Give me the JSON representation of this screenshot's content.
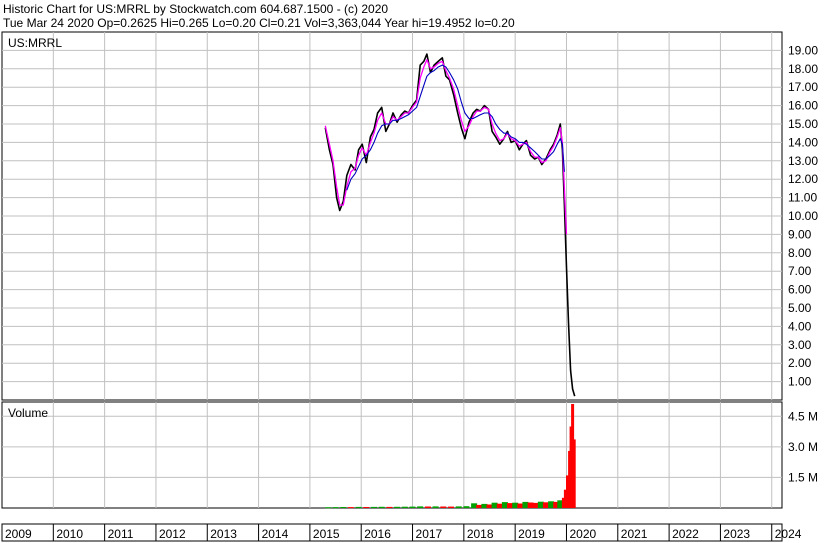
{
  "header": {
    "line1": "Historic Chart for US:MRRL by Stockwatch.com 604.687.1500 - (c) 2020",
    "line2": "Tue Mar 24 2020   Op=0.2625   Hi=0.265   Lo=0.20   Cl=0.21   Vol=3,363,044   Year hi=19.4952   lo=0.20"
  },
  "colors": {
    "background": "#ffffff",
    "grid": "#c0c0c0",
    "price_bars": "#000000",
    "moving_avg_short": "#ff00ff",
    "moving_avg_long": "#0000c0",
    "volume_up": "#00a000",
    "volume_down": "#ff0000"
  },
  "chart_data": [
    {
      "type": "line",
      "label": "US:MRRL",
      "x_ticks": [
        "2009",
        "2010",
        "2011",
        "2012",
        "2013",
        "2014",
        "2015",
        "2016",
        "2017",
        "2018",
        "2019",
        "2020",
        "2021",
        "2022",
        "2023",
        "2024"
      ],
      "y_ticks": [
        "19.00",
        "18.00",
        "17.00",
        "16.00",
        "15.00",
        "14.00",
        "13.00",
        "12.00",
        "11.00",
        "10.00",
        "9.00",
        "8.00",
        "7.00",
        "6.00",
        "5.00",
        "4.00",
        "3.00",
        "2.00",
        "1.00"
      ],
      "xlim": [
        2009.0,
        2024.2
      ],
      "ylim": [
        0,
        20.0
      ],
      "grid": true,
      "series": [
        {
          "values": [
            [
              2015.3,
              14.8
            ],
            [
              2015.38,
              13.6
            ],
            [
              2015.45,
              12.8
            ],
            [
              2015.52,
              11.0
            ],
            [
              2015.58,
              10.3
            ],
            [
              2015.65,
              10.8
            ],
            [
              2015.72,
              12.2
            ],
            [
              2015.8,
              12.8
            ],
            [
              2015.88,
              12.5
            ],
            [
              2015.95,
              13.6
            ],
            [
              2016.02,
              13.9
            ],
            [
              2016.1,
              12.9
            ],
            [
              2016.18,
              14.3
            ],
            [
              2016.25,
              14.7
            ],
            [
              2016.32,
              15.6
            ],
            [
              2016.4,
              15.9
            ],
            [
              2016.48,
              14.6
            ],
            [
              2016.55,
              15.0
            ],
            [
              2016.62,
              15.6
            ],
            [
              2016.7,
              15.1
            ],
            [
              2016.78,
              15.5
            ],
            [
              2016.85,
              15.7
            ],
            [
              2016.92,
              15.6
            ],
            [
              2017.0,
              16.0
            ],
            [
              2017.08,
              16.3
            ],
            [
              2017.15,
              18.2
            ],
            [
              2017.22,
              18.4
            ],
            [
              2017.28,
              18.8
            ],
            [
              2017.35,
              17.8
            ],
            [
              2017.42,
              18.2
            ],
            [
              2017.5,
              18.4
            ],
            [
              2017.58,
              18.6
            ],
            [
              2017.65,
              17.6
            ],
            [
              2017.72,
              17.4
            ],
            [
              2017.8,
              16.6
            ],
            [
              2017.88,
              15.6
            ],
            [
              2017.95,
              14.8
            ],
            [
              2018.02,
              14.2
            ],
            [
              2018.1,
              15.1
            ],
            [
              2018.18,
              15.6
            ],
            [
              2018.25,
              15.8
            ],
            [
              2018.32,
              15.7
            ],
            [
              2018.4,
              16.0
            ],
            [
              2018.48,
              15.8
            ],
            [
              2018.55,
              14.6
            ],
            [
              2018.62,
              14.3
            ],
            [
              2018.7,
              13.9
            ],
            [
              2018.78,
              14.2
            ],
            [
              2018.85,
              14.6
            ],
            [
              2018.92,
              14.0
            ],
            [
              2019.0,
              14.1
            ],
            [
              2019.08,
              13.6
            ],
            [
              2019.15,
              13.9
            ],
            [
              2019.22,
              14.1
            ],
            [
              2019.3,
              13.3
            ],
            [
              2019.38,
              13.1
            ],
            [
              2019.45,
              13.2
            ],
            [
              2019.52,
              12.8
            ],
            [
              2019.6,
              13.1
            ],
            [
              2019.68,
              13.6
            ],
            [
              2019.75,
              13.9
            ],
            [
              2019.82,
              14.4
            ],
            [
              2019.88,
              15.0
            ],
            [
              2019.92,
              13.6
            ],
            [
              2019.96,
              10.6
            ],
            [
              2020.0,
              7.2
            ],
            [
              2020.04,
              4.2
            ],
            [
              2020.08,
              1.6
            ],
            [
              2020.12,
              0.6
            ],
            [
              2020.16,
              0.21
            ]
          ]
        },
        {
          "name": "",
          "values": [
            [
              2015.3,
              14.9
            ],
            [
              2015.38,
              13.9
            ],
            [
              2015.45,
              13.0
            ],
            [
              2015.52,
              11.6
            ],
            [
              2015.58,
              10.6
            ],
            [
              2015.65,
              10.6
            ],
            [
              2015.72,
              11.6
            ],
            [
              2015.8,
              12.4
            ],
            [
              2015.88,
              12.6
            ],
            [
              2015.95,
              13.3
            ],
            [
              2016.02,
              13.7
            ],
            [
              2016.1,
              13.3
            ],
            [
              2016.18,
              14.0
            ],
            [
              2016.25,
              14.5
            ],
            [
              2016.32,
              15.2
            ],
            [
              2016.4,
              15.6
            ],
            [
              2016.48,
              15.0
            ],
            [
              2016.55,
              15.0
            ],
            [
              2016.62,
              15.4
            ],
            [
              2016.7,
              15.2
            ],
            [
              2016.78,
              15.4
            ],
            [
              2016.85,
              15.6
            ],
            [
              2016.92,
              15.6
            ],
            [
              2017.0,
              15.9
            ],
            [
              2017.08,
              16.2
            ],
            [
              2017.15,
              17.5
            ],
            [
              2017.22,
              18.1
            ],
            [
              2017.28,
              18.5
            ],
            [
              2017.35,
              18.0
            ],
            [
              2017.42,
              18.1
            ],
            [
              2017.5,
              18.3
            ],
            [
              2017.58,
              18.4
            ],
            [
              2017.65,
              17.9
            ],
            [
              2017.72,
              17.5
            ],
            [
              2017.8,
              16.9
            ],
            [
              2017.88,
              16.0
            ],
            [
              2017.95,
              15.2
            ],
            [
              2018.02,
              14.6
            ],
            [
              2018.1,
              14.9
            ],
            [
              2018.18,
              15.4
            ],
            [
              2018.25,
              15.7
            ],
            [
              2018.32,
              15.7
            ],
            [
              2018.4,
              15.9
            ],
            [
              2018.48,
              15.8
            ],
            [
              2018.55,
              15.0
            ],
            [
              2018.62,
              14.5
            ],
            [
              2018.7,
              14.1
            ],
            [
              2018.78,
              14.2
            ],
            [
              2018.85,
              14.5
            ],
            [
              2018.92,
              14.2
            ],
            [
              2019.0,
              14.1
            ],
            [
              2019.08,
              13.8
            ],
            [
              2019.15,
              13.9
            ],
            [
              2019.22,
              14.0
            ],
            [
              2019.3,
              13.5
            ],
            [
              2019.38,
              13.2
            ],
            [
              2019.45,
              13.2
            ],
            [
              2019.52,
              12.9
            ],
            [
              2019.6,
              13.0
            ],
            [
              2019.68,
              13.5
            ],
            [
              2019.75,
              13.8
            ],
            [
              2019.82,
              14.3
            ],
            [
              2019.88,
              14.8
            ],
            [
              2019.92,
              14.0
            ],
            [
              2019.96,
              11.5
            ],
            [
              2020.0,
              9.0
            ]
          ]
        },
        {
          "name": "",
          "values": [
            [
              2015.72,
              11.4
            ],
            [
              2015.8,
              12.0
            ],
            [
              2015.88,
              12.3
            ],
            [
              2015.95,
              12.7
            ],
            [
              2016.02,
              13.1
            ],
            [
              2016.1,
              13.3
            ],
            [
              2016.18,
              13.6
            ],
            [
              2016.25,
              14.0
            ],
            [
              2016.32,
              14.5
            ],
            [
              2016.4,
              14.9
            ],
            [
              2016.48,
              15.0
            ],
            [
              2016.55,
              15.0
            ],
            [
              2016.62,
              15.2
            ],
            [
              2016.7,
              15.2
            ],
            [
              2016.78,
              15.3
            ],
            [
              2016.85,
              15.4
            ],
            [
              2016.92,
              15.5
            ],
            [
              2017.0,
              15.7
            ],
            [
              2017.08,
              15.9
            ],
            [
              2017.15,
              16.5
            ],
            [
              2017.22,
              17.1
            ],
            [
              2017.28,
              17.6
            ],
            [
              2017.35,
              17.8
            ],
            [
              2017.42,
              17.9
            ],
            [
              2017.5,
              18.1
            ],
            [
              2017.58,
              18.2
            ],
            [
              2017.65,
              18.1
            ],
            [
              2017.72,
              17.8
            ],
            [
              2017.8,
              17.4
            ],
            [
              2017.88,
              16.9
            ],
            [
              2017.95,
              16.2
            ],
            [
              2018.02,
              15.6
            ],
            [
              2018.1,
              15.3
            ],
            [
              2018.18,
              15.3
            ],
            [
              2018.25,
              15.4
            ],
            [
              2018.32,
              15.5
            ],
            [
              2018.4,
              15.6
            ],
            [
              2018.48,
              15.6
            ],
            [
              2018.55,
              15.4
            ],
            [
              2018.62,
              15.0
            ],
            [
              2018.7,
              14.7
            ],
            [
              2018.78,
              14.5
            ],
            [
              2018.85,
              14.5
            ],
            [
              2018.92,
              14.3
            ],
            [
              2019.0,
              14.2
            ],
            [
              2019.08,
              14.0
            ],
            [
              2019.15,
              14.0
            ],
            [
              2019.22,
              13.9
            ],
            [
              2019.3,
              13.7
            ],
            [
              2019.38,
              13.5
            ],
            [
              2019.45,
              13.3
            ],
            [
              2019.52,
              13.1
            ],
            [
              2019.6,
              13.1
            ],
            [
              2019.68,
              13.3
            ],
            [
              2019.75,
              13.5
            ],
            [
              2019.82,
              13.9
            ],
            [
              2019.88,
              14.2
            ],
            [
              2019.92,
              13.9
            ],
            [
              2019.96,
              12.4
            ]
          ]
        }
      ]
    },
    {
      "type": "bar",
      "label": "Volume",
      "y_ticks": [
        "4.5 M",
        "3.0 M",
        "1.5 M"
      ],
      "ylim": [
        0,
        5200000
      ],
      "series": [
        {
          "values": [
            [
              2015.35,
              40000
            ],
            [
              2015.5,
              45000
            ],
            [
              2015.65,
              50000
            ],
            [
              2015.8,
              45000
            ],
            [
              2015.95,
              55000
            ],
            [
              2016.1,
              50000
            ],
            [
              2016.25,
              55000
            ],
            [
              2016.4,
              60000
            ],
            [
              2016.55,
              55000
            ],
            [
              2016.7,
              60000
            ],
            [
              2016.85,
              65000
            ],
            [
              2017.0,
              70000
            ],
            [
              2017.15,
              80000
            ],
            [
              2017.3,
              75000
            ],
            [
              2017.45,
              80000
            ],
            [
              2017.6,
              75000
            ],
            [
              2017.75,
              70000
            ],
            [
              2017.9,
              80000
            ],
            [
              2018.05,
              90000
            ],
            [
              2018.2,
              230000
            ],
            [
              2018.3,
              150000
            ],
            [
              2018.4,
              200000
            ],
            [
              2018.5,
              170000
            ],
            [
              2018.6,
              260000
            ],
            [
              2018.7,
              210000
            ],
            [
              2018.8,
              290000
            ],
            [
              2018.9,
              240000
            ],
            [
              2019.0,
              260000
            ],
            [
              2019.1,
              220000
            ],
            [
              2019.2,
              300000
            ],
            [
              2019.3,
              270000
            ],
            [
              2019.4,
              250000
            ],
            [
              2019.5,
              310000
            ],
            [
              2019.6,
              280000
            ],
            [
              2019.7,
              330000
            ],
            [
              2019.8,
              300000
            ],
            [
              2019.88,
              380000
            ],
            [
              2019.94,
              500000
            ],
            [
              2019.98,
              900000
            ],
            [
              2020.02,
              1600000
            ],
            [
              2020.06,
              2800000
            ],
            [
              2020.09,
              4000000
            ],
            [
              2020.12,
              5100000
            ],
            [
              2020.15,
              3363044
            ]
          ]
        }
      ]
    }
  ]
}
